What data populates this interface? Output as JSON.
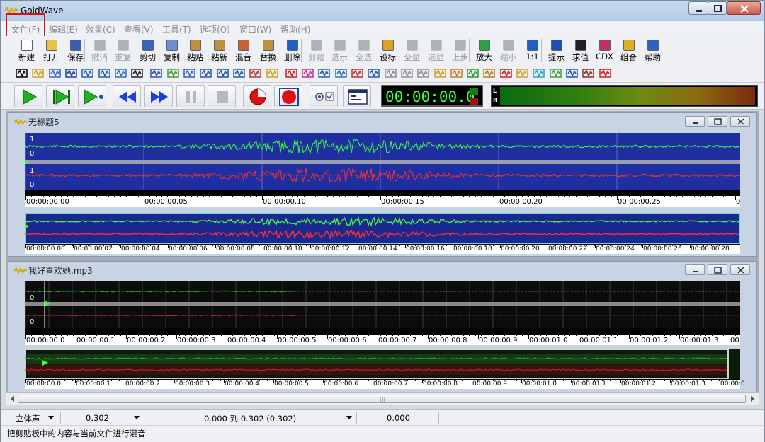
{
  "app": {
    "title": "GoldWave"
  },
  "menu": [
    {
      "key": "file",
      "label": "文件(F)"
    },
    {
      "key": "edit",
      "label": "编辑(E)"
    },
    {
      "key": "effects",
      "label": "效果(C)"
    },
    {
      "key": "view",
      "label": "查看(V)"
    },
    {
      "key": "tools",
      "label": "工具(T)"
    },
    {
      "key": "options",
      "label": "选项(O)"
    },
    {
      "key": "window",
      "label": "窗口(W)"
    },
    {
      "key": "help",
      "label": "帮助(H)"
    }
  ],
  "toolbar": [
    {
      "key": "new",
      "label": "新建",
      "color": "#ffffff",
      "disabled": false
    },
    {
      "key": "open",
      "label": "打开",
      "color": "#f0c040",
      "disabled": false
    },
    {
      "key": "save",
      "label": "保存",
      "color": "#3a5fb0",
      "disabled": false
    },
    {
      "key": "undo",
      "label": "撤消",
      "color": "#aab2bc",
      "disabled": true
    },
    {
      "key": "redo",
      "label": "重复",
      "color": "#aab2bc",
      "disabled": true
    },
    {
      "key": "cut",
      "label": "剪切",
      "color": "#3a64c0",
      "disabled": false
    },
    {
      "key": "copy",
      "label": "复制",
      "color": "#6f8fd0",
      "disabled": false
    },
    {
      "key": "paste",
      "label": "粘贴",
      "color": "#c0903a",
      "disabled": false
    },
    {
      "key": "paste-new",
      "label": "粘新",
      "color": "#c0903a",
      "disabled": false
    },
    {
      "key": "mix",
      "label": "混音",
      "color": "#d06030",
      "disabled": false
    },
    {
      "key": "replace",
      "label": "替换",
      "color": "#c0903a",
      "disabled": false
    },
    {
      "key": "delete",
      "label": "删除",
      "color": "#2060c0",
      "disabled": false
    },
    {
      "key": "trim",
      "label": "剪裁",
      "color": "#aab2bc",
      "disabled": true
    },
    {
      "key": "select-show",
      "label": "选示",
      "color": "#aab2bc",
      "disabled": true
    },
    {
      "key": "select-all",
      "label": "全选",
      "color": "#aab2bc",
      "disabled": true
    },
    {
      "key": "set-marker",
      "label": "设标",
      "color": "#e0a020",
      "disabled": false
    },
    {
      "key": "show-all",
      "label": "全显",
      "color": "#aab2bc",
      "disabled": true
    },
    {
      "key": "show-selection",
      "label": "选显",
      "color": "#aab2bc",
      "disabled": true
    },
    {
      "key": "previous",
      "label": "上步",
      "color": "#aab2bc",
      "disabled": true
    },
    {
      "key": "zoom-in",
      "label": "放大",
      "color": "#30a040",
      "disabled": false
    },
    {
      "key": "zoom-out",
      "label": "缩小",
      "color": "#aab2bc",
      "disabled": true
    },
    {
      "key": "zoom-1-1",
      "label": "1:1",
      "color": "#2060c0",
      "disabled": false
    },
    {
      "key": "cue",
      "label": "提示",
      "color": "#2050b0",
      "disabled": false
    },
    {
      "key": "evaluate",
      "label": "求值",
      "color": "#202020",
      "disabled": false
    },
    {
      "key": "cdx",
      "label": "CDX",
      "color": "#c03060",
      "disabled": false
    },
    {
      "key": "combine",
      "label": "组合",
      "color": "#e0b020",
      "disabled": false
    },
    {
      "key": "help",
      "label": "帮助",
      "color": "#3060c0",
      "disabled": false
    }
  ],
  "toolbar2_colors": [
    "#000000",
    "#d0a020",
    "#3a64c0",
    "#2040a0",
    "#2060c0",
    "#2060a0",
    "#3070c0",
    "#202020",
    "#3050c0",
    "#40a030",
    "#3060c0",
    "#3050c0",
    "#2050a0",
    "#2060a0",
    "#c03030",
    "#d0a020",
    "#d02020",
    "#c03080",
    "#2060c0",
    "#3070c0",
    "#c03030",
    "#2060c0",
    "#909090",
    "#909090",
    "#909090",
    "#d0a020",
    "#c08020",
    "#20a030",
    "#c08020",
    "#d02020",
    "#d0a020",
    "#30a0c0",
    "#40a040",
    "#2050c0",
    "#903020",
    "#d02020"
  ],
  "transport": {
    "time": "00:00:00.0",
    "meter_left": "L",
    "meter_right": "R"
  },
  "documents": [
    {
      "title": "无标题5",
      "channel_labels": [
        "1",
        "0",
        "1",
        "0"
      ],
      "ruler_labels": [
        "00:00:00.00",
        "00:00:00.05",
        "00:00:00.10",
        "00:00:00.15",
        "00:00:00.20",
        "00:00:00.25",
        "0"
      ],
      "overview_labels": [
        "00:00:00.00",
        "00:00:00.02",
        "00:00:00.04",
        "00:00:00.06",
        "00:00:00.08",
        "00:00:00.10",
        "00:00:00.12",
        "00:00:00.14",
        "00:00:00.16",
        "00:00:00.18",
        "00:00:00.20",
        "00:00:00.22",
        "00:00:00.24",
        "00:00:00.26",
        "00:00:00.28"
      ]
    },
    {
      "title": "我好喜欢她.mp3",
      "channel_labels": [
        "0",
        "0"
      ],
      "ruler_labels": [
        "00:00:00.0",
        "00:00:00.1",
        "00:00:00.2",
        "00:00:00.3",
        "00:00:00.4",
        "00:00:00.5",
        "00:00:00.6",
        "00:00:00.7",
        "00:00:00.8",
        "00:00:00.9",
        "00:00:01.0",
        "00:00:01.1",
        "00:00:01.2",
        "00:00:01.3",
        "00"
      ],
      "overview_labels": [
        "00:00:00.0",
        "00:00:00.1",
        "00:00:00.2",
        "00:00:00.3",
        "00:00:00.4",
        "00:00:00.5",
        "00:00:00.6",
        "00:00:00.7",
        "00:00:00.8",
        "00:00:00.9",
        "00:00:01.0",
        "00:00:01.1",
        "00:00:01.2",
        "00:00:01.3",
        "00:00:0"
      ]
    }
  ],
  "status": {
    "channel_mode": "立体声",
    "length": "0.302",
    "selection": "0.000 到 0.302 (0.302)",
    "position": "0.000",
    "hint": "把剪贴板中的内容与当前文件进行混音"
  }
}
